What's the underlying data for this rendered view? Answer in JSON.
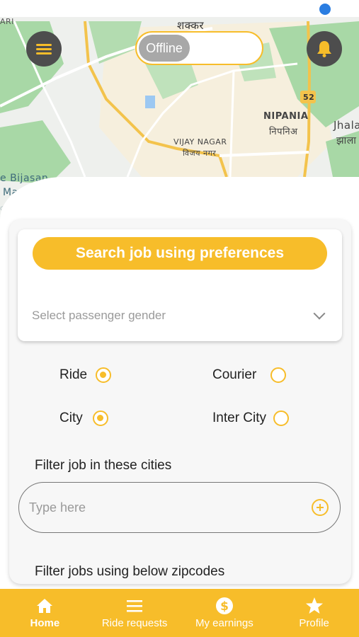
{
  "map": {
    "labels": {
      "top_left": "ARI",
      "top_hindi": "शक्कर",
      "highway": "52",
      "nipania": "NIPANIA",
      "nipania_hindi": "निपनिअ",
      "jhala": "Jhala",
      "jhala_hindi": "झाला",
      "vijay_nagar": "VIJAY NAGAR",
      "vijay_nagar_hindi": "विजय नगर",
      "bijasan": "e Bijasan",
      "mandir": "Mandi",
      "hindi_left": "ासन"
    }
  },
  "header": {
    "menu_icon": "hamburger-menu-icon",
    "toggle_label": "Offline",
    "notification_icon": "bell-icon"
  },
  "preferences": {
    "search_button_label": "Search job using preferences",
    "gender_placeholder": "Select passenger gender"
  },
  "job_types": {
    "ride_label": "Ride",
    "ride_selected": true,
    "courier_label": "Courier",
    "courier_selected": false,
    "city_label": "City",
    "city_selected": true,
    "intercity_label": "Inter City",
    "intercity_selected": false
  },
  "cities": {
    "title": "Filter job in these cities",
    "input_placeholder": "Type here",
    "add_icon": "plus-circle-icon"
  },
  "zipcodes": {
    "title": "Filter jobs using below zipcodes"
  },
  "bottom_nav": {
    "items": [
      {
        "label": "Home",
        "icon": "home-icon",
        "active": true
      },
      {
        "label": "Ride requests",
        "icon": "list-icon",
        "active": false
      },
      {
        "label": "My earnings",
        "icon": "dollar-icon",
        "active": false
      },
      {
        "label": "Profile",
        "icon": "star-icon",
        "active": false
      }
    ]
  },
  "colors": {
    "accent": "#f7bd2a",
    "dark_button": "#4d4d4d",
    "map_green": "#a8d8a6",
    "map_road": "#f3c34c"
  }
}
